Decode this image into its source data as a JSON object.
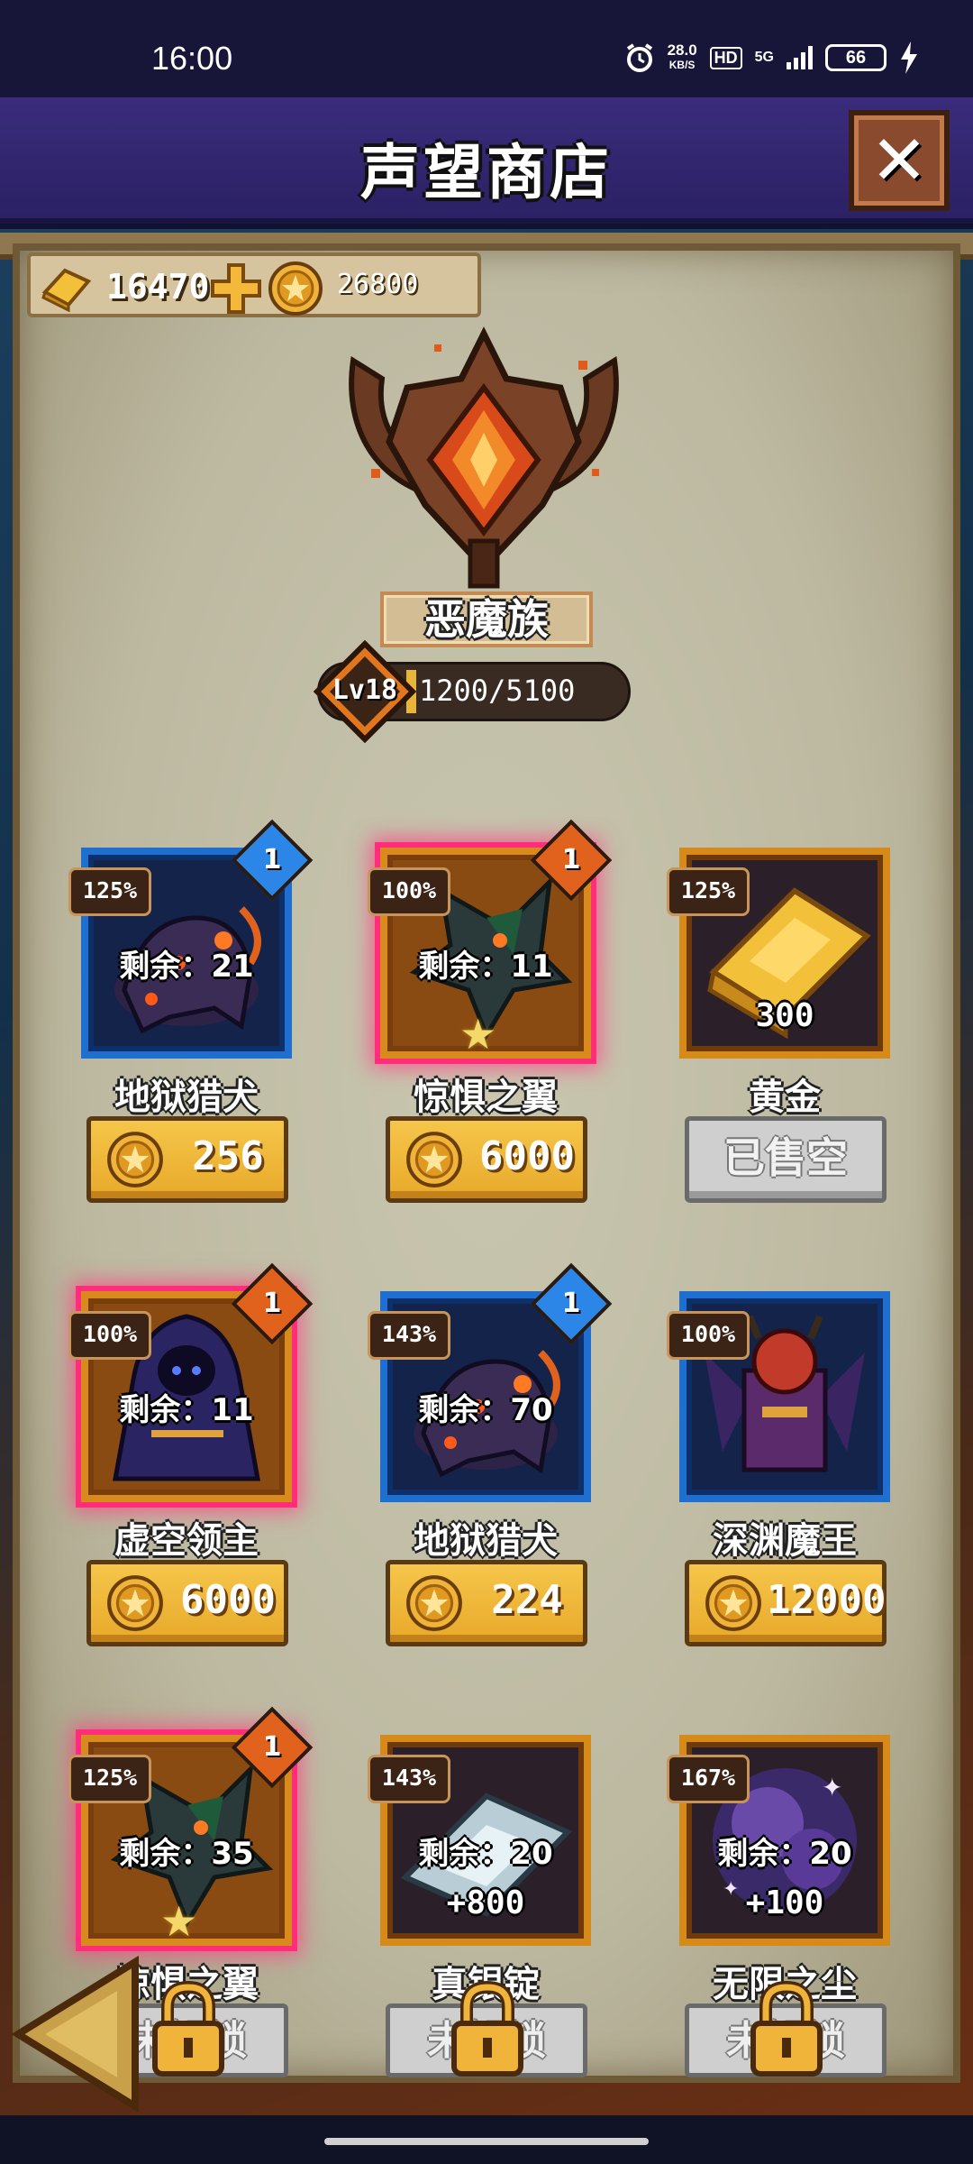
{
  "status_bar": {
    "time": "16:00",
    "net_speed_value": "28.0",
    "net_speed_unit": "KB/S",
    "hd_label": "HD",
    "network_label": "5G",
    "battery": "66"
  },
  "header": {
    "title": "声望商店",
    "close_icon": "close-icon"
  },
  "currencies": {
    "gold_bars": "16470",
    "coins": "26800"
  },
  "faction": {
    "name": "恶魔族",
    "level": "Lv18",
    "progress_text": "1200/5100",
    "progress_fraction": 0.235
  },
  "items": [
    {
      "name": "地狱猎犬",
      "pct": "125%",
      "rank": "1",
      "frame": "blue",
      "remaining": "剩余：21",
      "price": "256",
      "glow": false
    },
    {
      "name": "惊惧之翼",
      "pct": "100%",
      "rank": "1",
      "frame": "orange",
      "remaining": "剩余：11",
      "price": "6000",
      "glow": true,
      "star": true
    },
    {
      "name": "黄金",
      "pct": "125%",
      "frame": "gold",
      "qty": "300",
      "status": "已售空"
    },
    {
      "name": "虚空领主",
      "pct": "100%",
      "rank": "1",
      "frame": "orange",
      "remaining": "剩余：11",
      "price": "6000",
      "glow": true
    },
    {
      "name": "地狱猎犬",
      "pct": "143%",
      "rank": "1",
      "frame": "blue",
      "remaining": "剩余：70",
      "price": "224",
      "glow": false
    },
    {
      "name": "深渊魔王",
      "pct": "100%",
      "frame": "blue",
      "price": "12000",
      "glow": false
    },
    {
      "name": "惊惧之翼",
      "pct": "125%",
      "rank": "1",
      "frame": "orange",
      "remaining": "剩余：35",
      "status": "未解锁",
      "glow": true,
      "star": true
    },
    {
      "name": "真银锭",
      "pct": "143%",
      "frame": "gold",
      "remaining": "剩余：20",
      "qty": "+800",
      "status": "未解锁"
    },
    {
      "name": "无限之尘",
      "pct": "167%",
      "frame": "gold",
      "remaining": "剩余：20",
      "qty": "+100",
      "status": "未解锁"
    }
  ],
  "colors": {
    "title_bar": "#33276f",
    "price_button": "#f0b73a",
    "blue_frame": "#1f6fd0",
    "orange_frame": "#d98a1c",
    "glow": "#ff2d7a"
  }
}
